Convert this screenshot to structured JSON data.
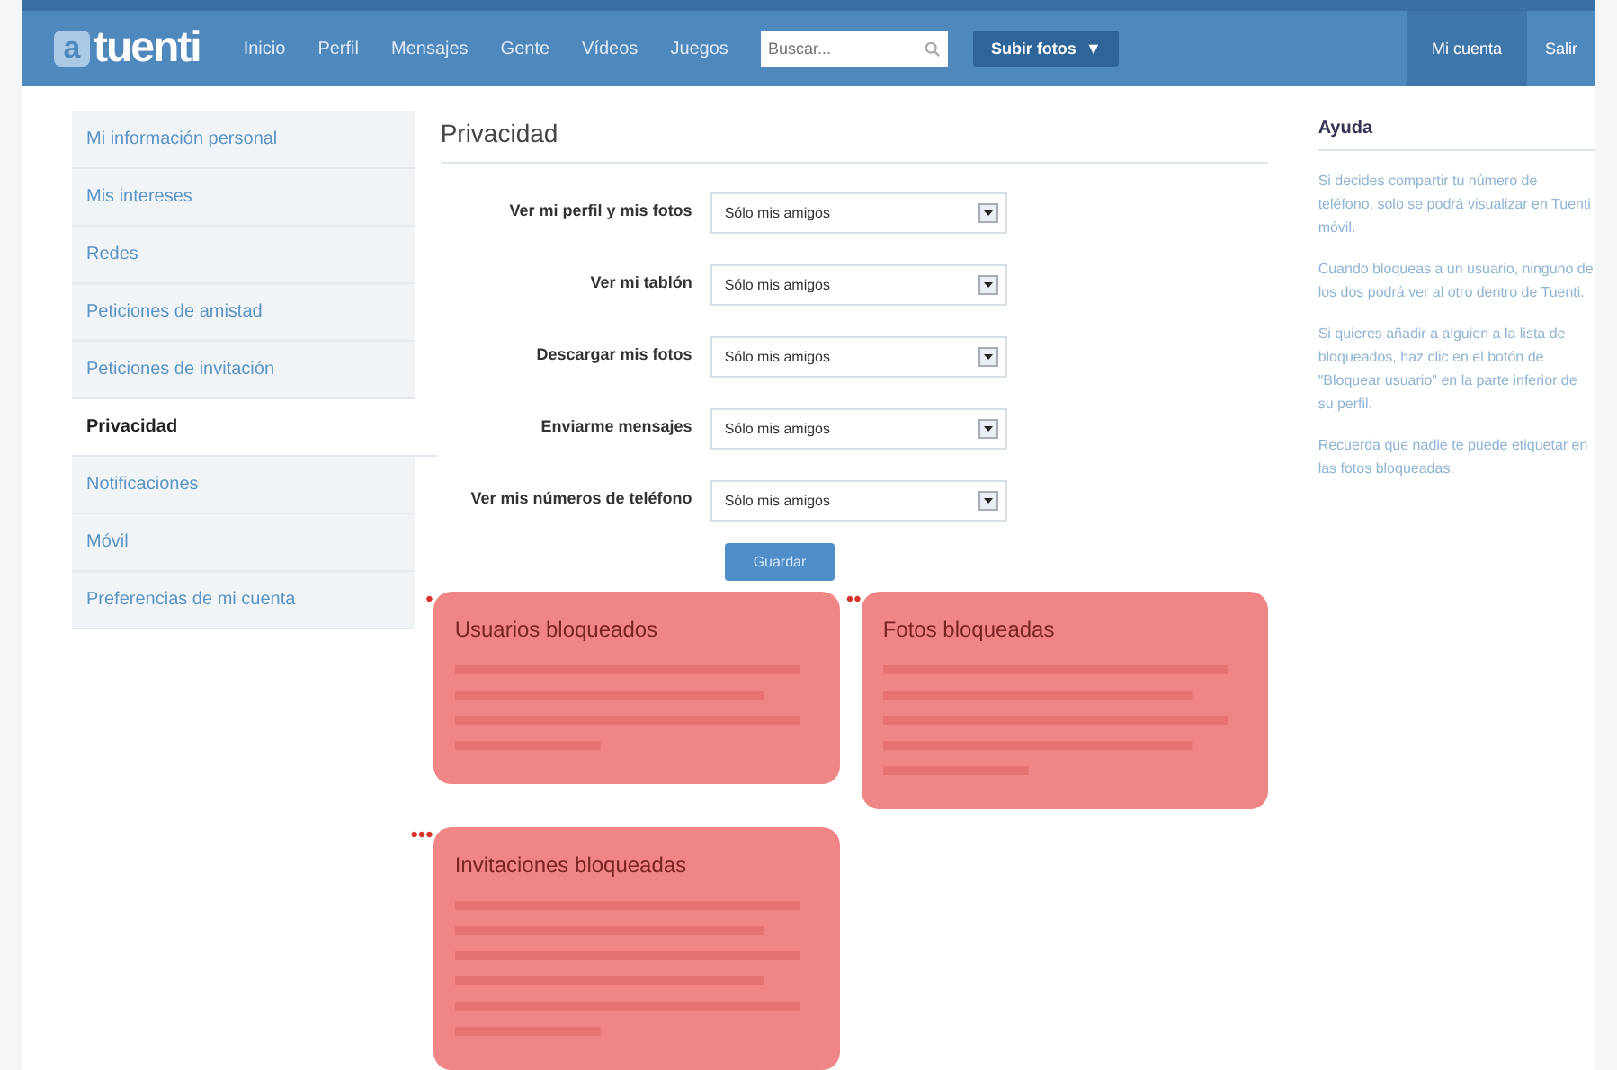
{
  "topbar": {
    "logo_mark": "a",
    "logo": "tuenti",
    "nav": [
      {
        "label": "Inicio"
      },
      {
        "label": "Perfil"
      },
      {
        "label": "Mensajes"
      },
      {
        "label": "Gente"
      },
      {
        "label": "Vídeos"
      },
      {
        "label": "Juegos"
      }
    ],
    "search": {
      "placeholder": "Buscar..."
    },
    "upload": "Subir fotos",
    "upload_caret": "▼",
    "account": [
      {
        "label": "Mi cuenta",
        "selected": true
      },
      {
        "label": "Salir",
        "selected": false
      }
    ]
  },
  "sidebar": {
    "items": [
      {
        "label": "Mi información personal",
        "selected": false
      },
      {
        "label": "Mis intereses",
        "selected": false
      },
      {
        "label": "Redes",
        "selected": false
      },
      {
        "label": "Peticiones de amistad",
        "selected": false
      },
      {
        "label": "Peticiones de invitación",
        "selected": false
      },
      {
        "label": "Privacidad",
        "selected": true
      },
      {
        "label": "Notificaciones",
        "selected": false
      },
      {
        "label": "Móvil",
        "selected": false
      },
      {
        "label": "Preferencias de mi cuenta",
        "selected": false
      }
    ]
  },
  "privacy": {
    "title": "Privacidad",
    "settings": [
      {
        "label": "Ver mi perfil y mis fotos",
        "value": "Sólo mis amigos"
      },
      {
        "label": "Ver mi tablón",
        "value": "Sólo mis amigos"
      },
      {
        "label": "Descargar mis fotos",
        "value": "Sólo mis amigos"
      },
      {
        "label": "Enviarme mensajes",
        "value": "Sólo mis amigos"
      },
      {
        "label": "Ver mis números de teléfono",
        "value": "Sólo mis amigos"
      }
    ],
    "save": "Guardar"
  },
  "blocked_cards": [
    {
      "title": "Usuarios bloqueados",
      "marker": "•"
    },
    {
      "title": "Fotos bloqueadas",
      "marker": "••"
    },
    {
      "title": "Invitaciones bloqueadas",
      "marker": "•••"
    }
  ],
  "help": {
    "title": "Ayuda",
    "paragraphs": [
      "Si decides compartir tu número de teléfono, solo se podrá visualizar en Tuenti móvil.",
      "Cuando bloqueas a un usuario, ninguno de los dos podrá ver al otro dentro de Tuenti.",
      "Si quieres añadir a alguien a la lista de bloqueados, haz clic en el botón de \"Bloquear usuario\" en la parte inferior de su perfil.",
      "Recuerda que nadie te puede etiquetar en las fotos bloqueadas."
    ]
  }
}
